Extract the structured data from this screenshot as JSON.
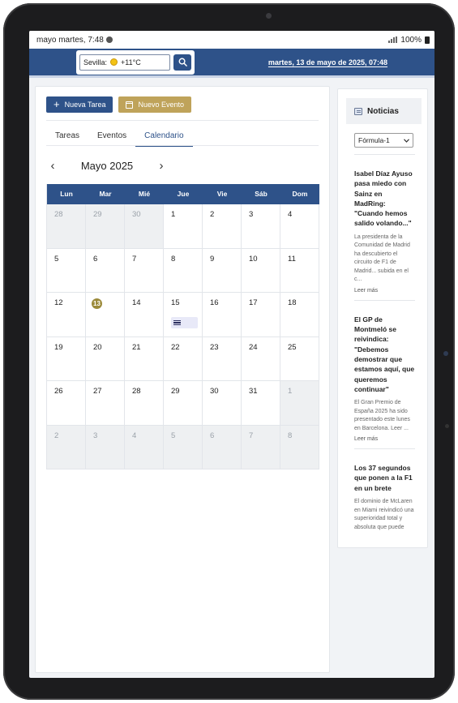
{
  "status_bar": {
    "time": "mayo martes, 7:48",
    "battery": "100%"
  },
  "header": {
    "weather_text": "Sevilla:",
    "temperature": "+11°C",
    "datetime": "martes, 13 de mayo de 2025, 07:48"
  },
  "actions": {
    "new_task": "Nueva Tarea",
    "new_event": "Nuevo Evento"
  },
  "tabs": [
    {
      "label": "Tareas",
      "active": false
    },
    {
      "label": "Eventos",
      "active": false
    },
    {
      "label": "Calendario",
      "active": true
    }
  ],
  "calendar": {
    "month_title": "Mayo 2025",
    "weekdays": [
      "Lun",
      "Mar",
      "Mié",
      "Jue",
      "Vie",
      "Sáb",
      "Dom"
    ],
    "weeks": [
      [
        {
          "d": "28",
          "m": true
        },
        {
          "d": "29",
          "m": true
        },
        {
          "d": "30",
          "m": true
        },
        {
          "d": "1"
        },
        {
          "d": "2"
        },
        {
          "d": "3"
        },
        {
          "d": "4"
        }
      ],
      [
        {
          "d": "5"
        },
        {
          "d": "6"
        },
        {
          "d": "7"
        },
        {
          "d": "8"
        },
        {
          "d": "9"
        },
        {
          "d": "10"
        },
        {
          "d": "11"
        }
      ],
      [
        {
          "d": "12"
        },
        {
          "d": "13",
          "today": true
        },
        {
          "d": "14"
        },
        {
          "d": "15",
          "task": true
        },
        {
          "d": "16"
        },
        {
          "d": "17"
        },
        {
          "d": "18"
        }
      ],
      [
        {
          "d": "19"
        },
        {
          "d": "20"
        },
        {
          "d": "21"
        },
        {
          "d": "22"
        },
        {
          "d": "23"
        },
        {
          "d": "24"
        },
        {
          "d": "25"
        }
      ],
      [
        {
          "d": "26"
        },
        {
          "d": "27"
        },
        {
          "d": "28"
        },
        {
          "d": "29"
        },
        {
          "d": "30"
        },
        {
          "d": "31"
        },
        {
          "d": "1",
          "m": true
        }
      ],
      [
        {
          "d": "2",
          "m": true
        },
        {
          "d": "3",
          "m": true
        },
        {
          "d": "4",
          "m": true
        },
        {
          "d": "5",
          "m": true
        },
        {
          "d": "6",
          "m": true
        },
        {
          "d": "7",
          "m": true
        },
        {
          "d": "8",
          "m": true
        }
      ]
    ]
  },
  "news": {
    "title": "Noticias",
    "selected_category": "Fórmula-1",
    "items": [
      {
        "title": "Isabel Díaz Ayuso pasa miedo con Sainz en MadRing: \"Cuando hemos salido volando...\"",
        "excerpt": "La presidenta de la Comunidad de Madrid ha descubierto el circuito de F1 de Madrid... subida en el c...",
        "more": "Leer más"
      },
      {
        "title": "El GP de Montmeló se reivindica: \"Debemos demostrar que estamos aquí, que queremos continuar\"",
        "excerpt": "El Gran Premio de España 2025 ha sido presentado este lunes en Barcelona. Leer ...",
        "more": "Leer más"
      },
      {
        "title": "Los 37 segundos que ponen a la F1 en un brete",
        "excerpt": "El dominio de McLaren en Miami reivindicó una superioridad total y absoluta que puede",
        "more": ""
      }
    ]
  }
}
